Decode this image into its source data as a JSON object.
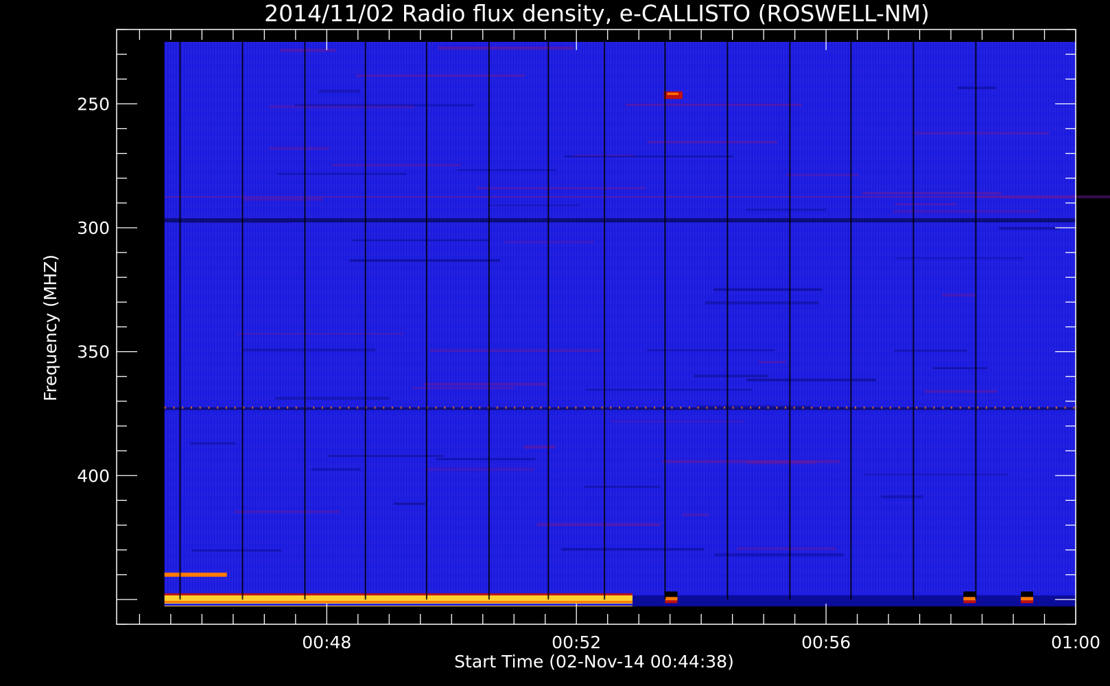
{
  "chart_data": {
    "type": "heatmap",
    "title": "2014/11/02  Radio flux density, e-CALLISTO (ROSWELL-NM)",
    "xlabel": "Start Time (02-Nov-14 00:44:38)",
    "ylabel": "Frequency (MHZ)",
    "x_start": "00:44:38",
    "xlim_minutes": [
      44.633,
      60.0
    ],
    "ylim_mhz": [
      220,
      460
    ],
    "y_inverted": true,
    "x_ticks": [
      {
        "label": "00:48",
        "minute": 48
      },
      {
        "label": "00:52",
        "minute": 52
      },
      {
        "label": "00:56",
        "minute": 56
      },
      {
        "label": "01:00",
        "minute": 60
      }
    ],
    "y_ticks": [
      {
        "label": "250",
        "mhz": 250
      },
      {
        "label": "300",
        "mhz": 300
      },
      {
        "label": "350",
        "mhz": 350
      },
      {
        "label": "400",
        "mhz": 400
      }
    ],
    "data_extent": {
      "minute_start": 45.4,
      "minute_end": 60.0,
      "mhz_top": 225,
      "mhz_bottom": 450
    },
    "colormap": [
      "#000000",
      "#0a0a6a",
      "#1e1ee6",
      "#6a1a9a",
      "#c01010",
      "#ff7a00",
      "#ffd030"
    ],
    "background_color": "#1e1ee6",
    "gap_minutes": [
      45.65,
      46.65,
      47.65,
      48.62,
      49.6,
      50.6,
      51.55,
      52.45,
      53.42,
      54.42,
      55.42,
      56.4,
      57.4,
      58.4
    ],
    "features": [
      {
        "type": "burst",
        "minute_start": 53.4,
        "minute_end": 53.7,
        "mhz_start": 245,
        "mhz_end": 248
      },
      {
        "type": "band",
        "mhz": 297,
        "intensity": "low"
      },
      {
        "type": "band",
        "mhz": 373,
        "intensity": "mixed"
      },
      {
        "type": "band",
        "mhz": 440,
        "intensity": "high",
        "minute_start": 45.4,
        "minute_end": 46.4
      },
      {
        "type": "band",
        "mhz": 450,
        "intensity": "high",
        "minute_start": 45.4,
        "minute_end": 52.9
      }
    ]
  }
}
